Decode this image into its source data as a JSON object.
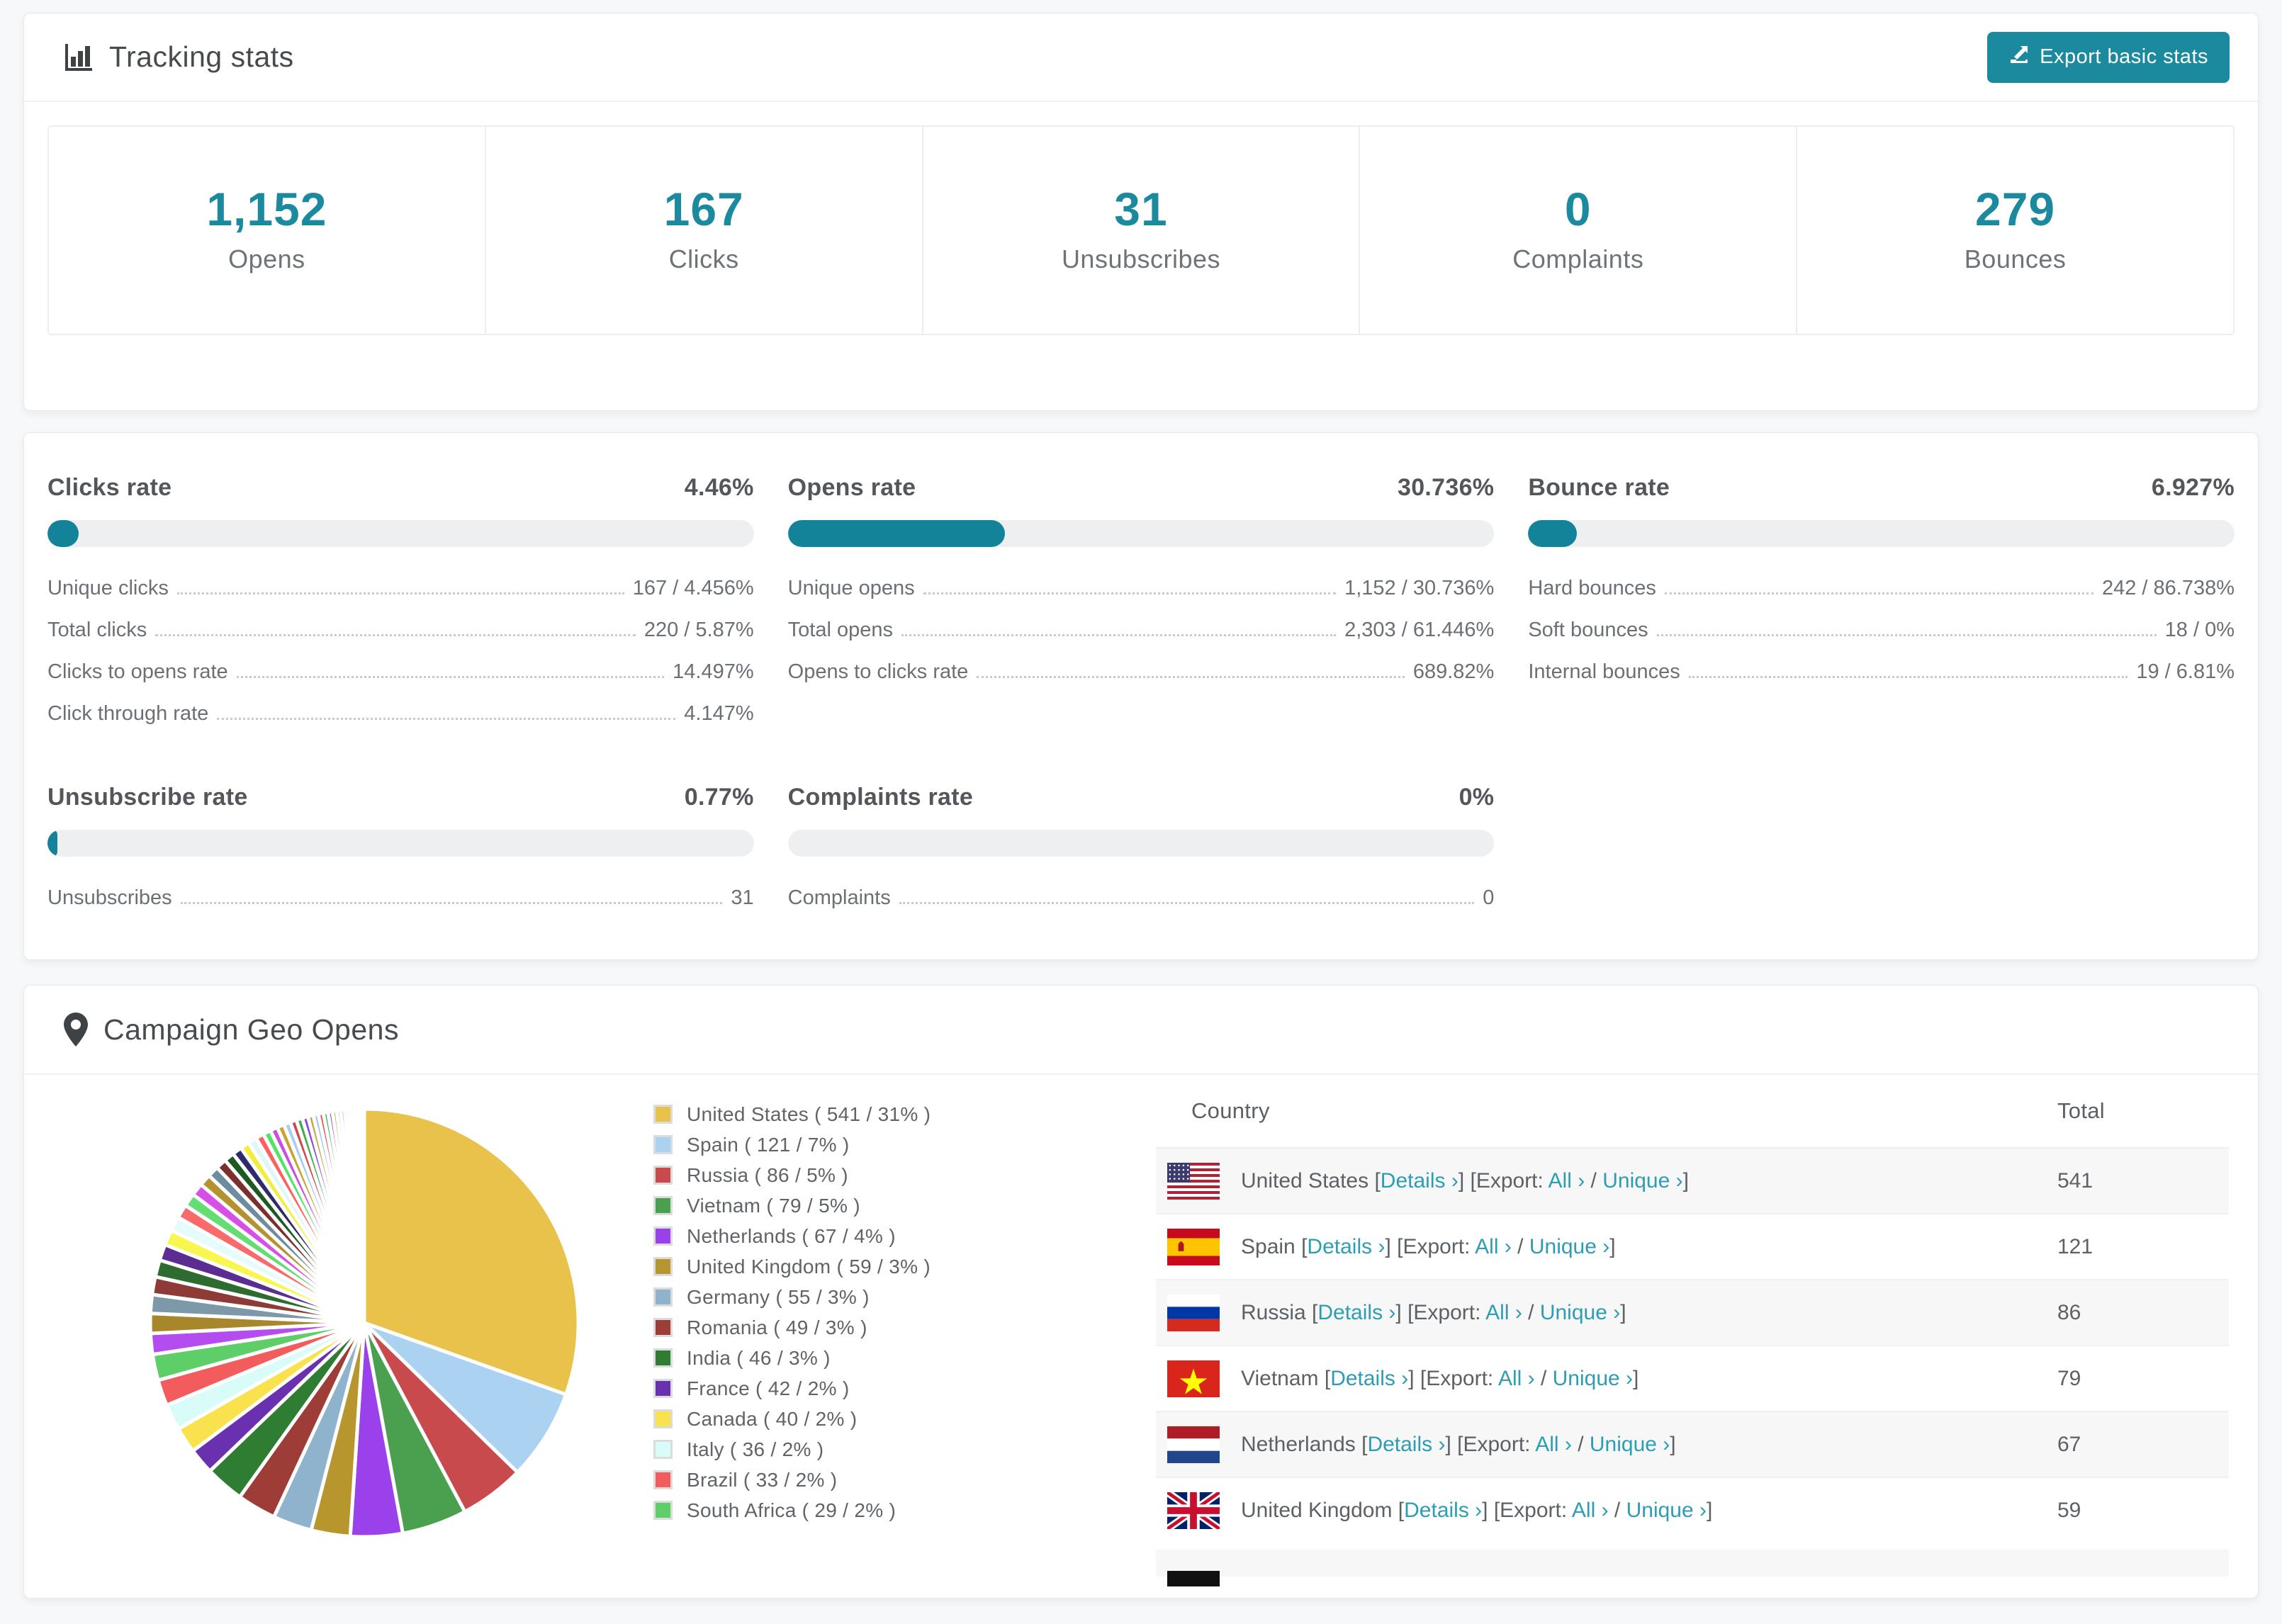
{
  "tracking": {
    "title": "Tracking stats",
    "export_button": "Export basic stats",
    "summary": [
      {
        "value": "1,152",
        "label": "Opens"
      },
      {
        "value": "167",
        "label": "Clicks"
      },
      {
        "value": "31",
        "label": "Unsubscribes"
      },
      {
        "value": "0",
        "label": "Complaints"
      },
      {
        "value": "279",
        "label": "Bounces"
      }
    ]
  },
  "rates": {
    "blocks": [
      {
        "title": "Clicks rate",
        "pct_label": "4.46%",
        "pct": 4.46,
        "rows": [
          {
            "label": "Unique clicks",
            "value": "167 / 4.456%"
          },
          {
            "label": "Total clicks",
            "value": "220 / 5.87%"
          },
          {
            "label": "Clicks to opens rate",
            "value": "14.497%"
          },
          {
            "label": "Click through rate",
            "value": "4.147%"
          }
        ]
      },
      {
        "title": "Opens rate",
        "pct_label": "30.736%",
        "pct": 30.736,
        "rows": [
          {
            "label": "Unique opens",
            "value": "1,152 / 30.736%"
          },
          {
            "label": "Total opens",
            "value": "2,303 / 61.446%"
          },
          {
            "label": "Opens to clicks rate",
            "value": "689.82%"
          }
        ]
      },
      {
        "title": "Bounce rate",
        "pct_label": "6.927%",
        "pct": 6.927,
        "rows": [
          {
            "label": "Hard bounces",
            "value": "242 / 86.738%"
          },
          {
            "label": "Soft bounces",
            "value": "18 / 0%"
          },
          {
            "label": "Internal bounces",
            "value": "19 / 6.81%"
          }
        ]
      },
      {
        "title": "Unsubscribe rate",
        "pct_label": "0.77%",
        "pct": 0.77,
        "rows": [
          {
            "label": "Unsubscribes",
            "value": "31"
          }
        ]
      },
      {
        "title": "Complaints rate",
        "pct_label": "0%",
        "pct": 0,
        "rows": [
          {
            "label": "Complaints",
            "value": "0"
          }
        ]
      }
    ]
  },
  "geo": {
    "title": "Campaign Geo Opens",
    "columns": {
      "country": "Country",
      "total": "Total"
    },
    "link_parts": {
      "details": "Details ›",
      "export_prefix": "Export:",
      "all": "All ›",
      "unique": "Unique ›"
    },
    "rows": [
      {
        "country": "United States",
        "flag": "us",
        "total": "541"
      },
      {
        "country": "Spain",
        "flag": "es",
        "total": "121"
      },
      {
        "country": "Russia",
        "flag": "ru",
        "total": "86"
      },
      {
        "country": "Vietnam",
        "flag": "vn",
        "total": "79"
      },
      {
        "country": "Netherlands",
        "flag": "nl",
        "total": "67"
      },
      {
        "country": "United Kingdom",
        "flag": "gb",
        "total": "59"
      }
    ],
    "partial_row_flag": "de"
  },
  "chart_data": {
    "type": "pie",
    "title": "Campaign Geo Opens",
    "legend_position": "right",
    "start_angle_deg": 0,
    "direction": "clockwise",
    "series": [
      {
        "name": "United States",
        "count": 541,
        "pct": 31,
        "color": "#e8c24a",
        "label": "United States ( 541 / 31% )"
      },
      {
        "name": "Spain",
        "count": 121,
        "pct": 7,
        "color": "#abd3f1",
        "label": "Spain ( 121 / 7% )"
      },
      {
        "name": "Russia",
        "count": 86,
        "pct": 5,
        "color": "#c94a4d",
        "label": "Russia ( 86 / 5% )"
      },
      {
        "name": "Vietnam",
        "count": 79,
        "pct": 5,
        "color": "#4ba04f",
        "label": "Vietnam ( 79 / 5% )"
      },
      {
        "name": "Netherlands",
        "count": 67,
        "pct": 4,
        "color": "#9a41eb",
        "label": "Netherlands ( 67 / 4% )"
      },
      {
        "name": "United Kingdom",
        "count": 59,
        "pct": 3,
        "color": "#b8962e",
        "label": "United Kingdom ( 59 / 3% )"
      },
      {
        "name": "Germany",
        "count": 55,
        "pct": 3,
        "color": "#8fb3cc",
        "label": "Germany ( 55 / 3% )"
      },
      {
        "name": "Romania",
        "count": 49,
        "pct": 3,
        "color": "#9e3c38",
        "label": "Romania ( 49 / 3% )"
      },
      {
        "name": "India",
        "count": 46,
        "pct": 3,
        "color": "#2f7d33",
        "label": "India ( 46 / 3% )"
      },
      {
        "name": "France",
        "count": 42,
        "pct": 2,
        "color": "#6930b0",
        "label": "France ( 42 / 2% )"
      },
      {
        "name": "Canada",
        "count": 40,
        "pct": 2,
        "color": "#fae14e",
        "label": "Canada ( 40 / 2% )"
      },
      {
        "name": "Italy",
        "count": 36,
        "pct": 2,
        "color": "#d9fcf8",
        "label": "Italy ( 36 / 2% )"
      },
      {
        "name": "Brazil",
        "count": 33,
        "pct": 2,
        "color": "#f25c5c",
        "label": "Brazil ( 33 / 2% )"
      },
      {
        "name": "South Africa",
        "count": 29,
        "pct": 2,
        "color": "#5ecf68",
        "label": "South Africa ( 29 / 2% )"
      }
    ],
    "other_slices": {
      "note": "unlabeled thin slices visible in pie, estimated pct",
      "values": [
        1.6,
        1.52,
        1.44,
        1.37,
        1.3,
        1.24,
        1.18,
        1.12,
        1.06,
        1.01,
        0.96,
        0.91,
        0.86,
        0.82,
        0.78,
        0.74,
        0.7,
        0.67,
        0.63,
        0.6,
        0.57,
        0.54,
        0.52,
        0.49,
        0.47,
        0.44,
        0.42,
        0.4,
        0.38,
        0.36,
        0.34,
        0.33,
        0.31,
        0.3,
        0.28,
        0.27,
        0.25,
        0.24,
        0.23,
        0.22
      ],
      "palette": [
        "#b44df0",
        "#a8862c",
        "#7d98a8",
        "#8e3a36",
        "#2d6b2f",
        "#5c2d91",
        "#f7f750",
        "#e6fcfc",
        "#f96b6b",
        "#64dd72",
        "#d84fe8",
        "#b3922f",
        "#6e8ca0",
        "#7e2f2b",
        "#1d5a22",
        "#2e2a6e",
        "#f2ee3e",
        "#dff6ff",
        "#ff5f5f",
        "#54e464",
        "#c94fe0",
        "#caa22e",
        "#a6cef2",
        "#d24848",
        "#3fae4d",
        "#8e45d8",
        "#c9a43a",
        "#9ec8ef",
        "#e05050",
        "#49b957",
        "#9a50e0",
        "#d0aa40",
        "#aad2f2",
        "#e85858",
        "#55c562",
        "#a858e8",
        "#d8b248",
        "#b6d8f4",
        "#f06060",
        "#60cc6c"
      ]
    }
  },
  "colors": {
    "accent_teal": "#1b8a9e",
    "bar_teal": "#13839a",
    "link_teal": "#2d9db4"
  }
}
